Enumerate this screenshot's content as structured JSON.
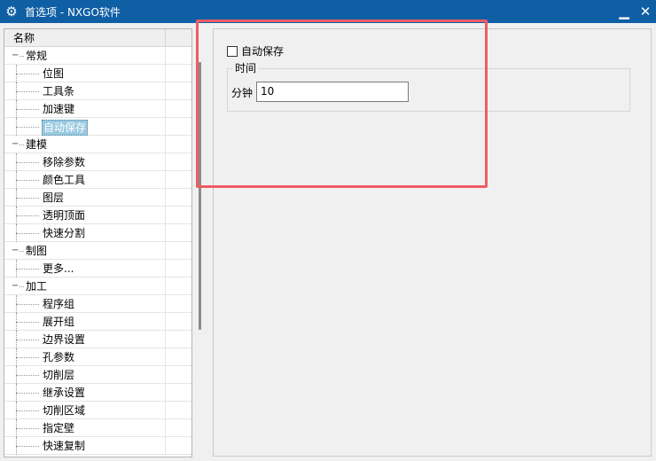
{
  "window": {
    "title": "首选项 - NXGO软件",
    "icons": {
      "app": "gear-icon",
      "minimize": "minimize-icon",
      "close": "close-icon"
    },
    "accent": "#0f5fa5"
  },
  "tree": {
    "column_header": "名称",
    "items": [
      {
        "label": "常规",
        "level": 0,
        "expanded": true
      },
      {
        "label": "位图",
        "level": 1
      },
      {
        "label": "工具条",
        "level": 1
      },
      {
        "label": "加速键",
        "level": 1
      },
      {
        "label": "自动保存",
        "level": 1,
        "selected": true
      },
      {
        "label": "建模",
        "level": 0,
        "expanded": true
      },
      {
        "label": "移除参数",
        "level": 1
      },
      {
        "label": "颜色工具",
        "level": 1
      },
      {
        "label": "图层",
        "level": 1
      },
      {
        "label": "透明顶面",
        "level": 1
      },
      {
        "label": "快速分割",
        "level": 1
      },
      {
        "label": "制图",
        "level": 0,
        "expanded": true
      },
      {
        "label": "更多...",
        "level": 1
      },
      {
        "label": "加工",
        "level": 0,
        "expanded": true
      },
      {
        "label": "程序组",
        "level": 1
      },
      {
        "label": "展开组",
        "level": 1
      },
      {
        "label": "边界设置",
        "level": 1
      },
      {
        "label": "孔参数",
        "level": 1
      },
      {
        "label": "切削层",
        "level": 1
      },
      {
        "label": "继承设置",
        "level": 1
      },
      {
        "label": "切削区域",
        "level": 1
      },
      {
        "label": "指定壁",
        "level": 1
      },
      {
        "label": "快速复制",
        "level": 1
      }
    ],
    "selection_color": "#99c9e0"
  },
  "settings": {
    "autosave_label": "自动保存",
    "autosave_checked": false,
    "time_group_label": "时间",
    "minute_label": "分钟",
    "minute_value": "10"
  },
  "annotation": {
    "color": "#ef5b62"
  }
}
